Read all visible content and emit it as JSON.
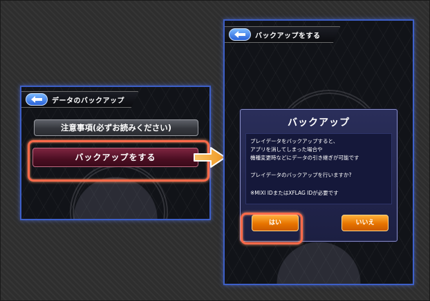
{
  "left_screen": {
    "title": "データのバックアップ",
    "notice_button": "注意事項(必ずお読みください)",
    "backup_button": "バックアップをする"
  },
  "right_screen": {
    "title": "バックアップをする",
    "dialog": {
      "title": "バックアップ",
      "message_lines": [
        "プレイデータをバックアップすると、",
        "アプリを消してしまった場合や",
        "機種変更時などにデータの引き継ぎが可能です",
        "プレイデータのバックアップを行いますか?",
        "※MIXI IDまたはXFLAG IDが必要です"
      ],
      "yes_button": "はい",
      "no_button": "いいえ"
    }
  },
  "colors": {
    "highlight": "#ff6a4a",
    "screen_border": "#3d5fc8",
    "arrow": "#f0961e",
    "dialog_button": "#e77400"
  }
}
